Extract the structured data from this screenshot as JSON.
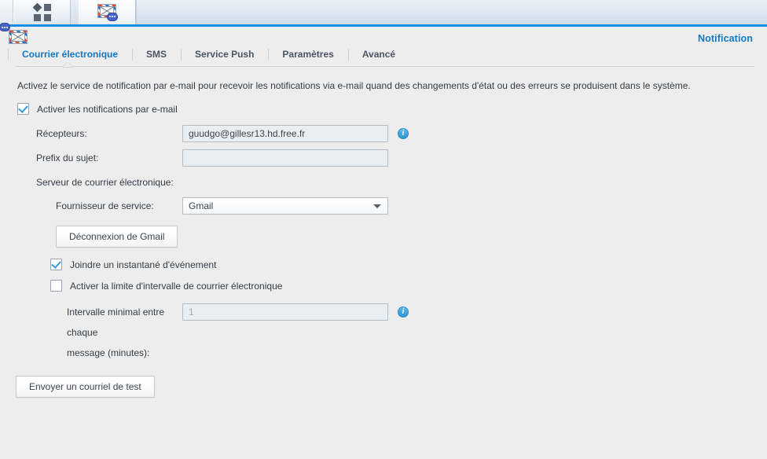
{
  "taskbar": {
    "apps_button_name": "Applications",
    "notification_button_name": "Notification"
  },
  "app": {
    "title": "Notification",
    "icon": "notification-envelope-icon"
  },
  "tabs": [
    {
      "label": "Courrier électronique",
      "active": true
    },
    {
      "label": "SMS",
      "active": false
    },
    {
      "label": "Service Push",
      "active": false
    },
    {
      "label": "Paramètres",
      "active": false
    },
    {
      "label": "Avancé",
      "active": false
    }
  ],
  "main": {
    "description": "Activez le service de notification par e-mail pour recevoir les notifications via e-mail quand des changements d'état ou des erreurs se produisent dans le système.",
    "enable_notifications": {
      "label": "Activer les notifications par e-mail",
      "checked": true
    },
    "recipients": {
      "label": "Récepteurs:",
      "value": "guudgo@gillesr13.hd.free.fr",
      "placeholder": "",
      "info": "i"
    },
    "subject_prefix": {
      "label": "Prefix du sujet:",
      "value": "",
      "placeholder": ""
    },
    "mail_server_label": "Serveur de courrier électronique:",
    "service_provider": {
      "label": "Fournisseur de service:",
      "value": "Gmail",
      "options": [
        "Gmail"
      ]
    },
    "disconnect_button": "Déconnexion de Gmail",
    "attach_snapshot": {
      "label": "Joindre un instantané d'événement",
      "checked": true
    },
    "enable_interval_limit": {
      "label": "Activer la limite d'intervalle de courrier électronique",
      "checked": false
    },
    "min_interval": {
      "label_line1": "Intervalle minimal entre chaque",
      "label_line2": "message (minutes):",
      "value": "1",
      "disabled": true,
      "info": "i"
    },
    "send_test_button": "Envoyer un courriel de test"
  },
  "colors": {
    "accent": "#1577c4",
    "title": "#0f7ac4",
    "taskbar_border": "#1a8fe0",
    "checkbox_check": "#2f9ae0",
    "info_badge": "#2b93d6",
    "page_background": "#ededed"
  }
}
